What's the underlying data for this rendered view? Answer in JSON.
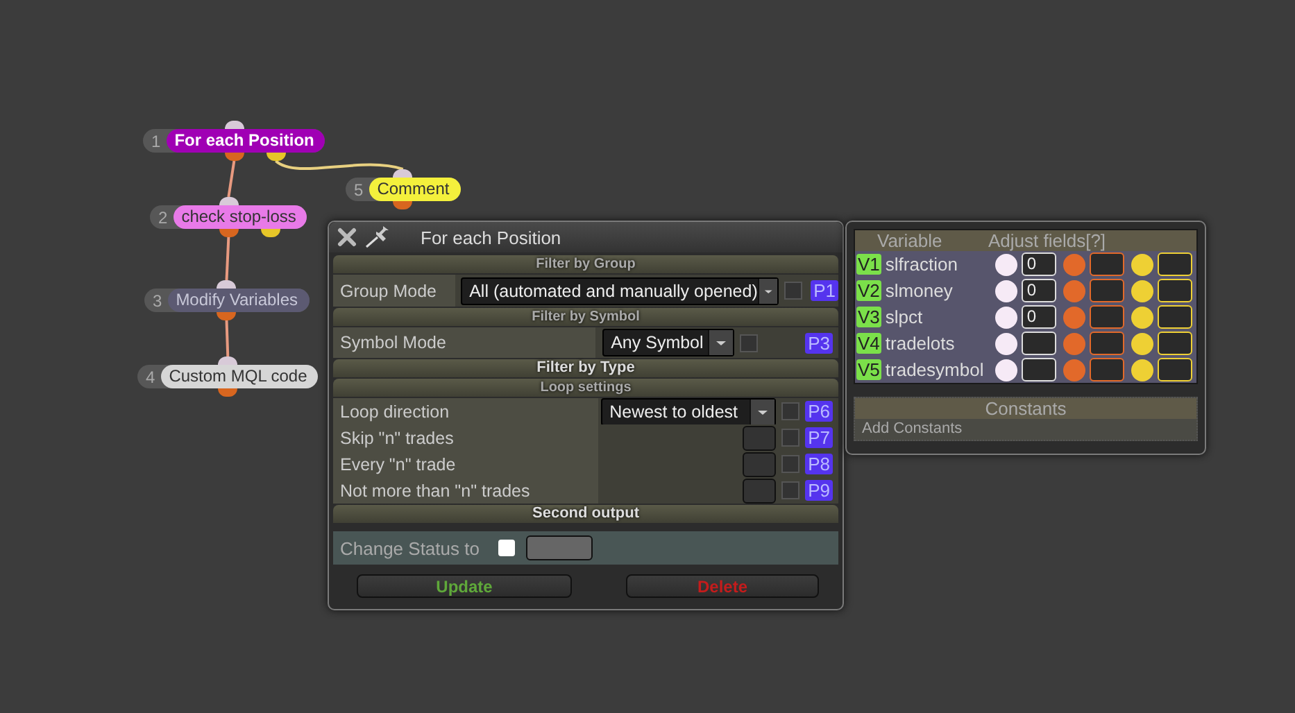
{
  "nodes": [
    {
      "number": "1",
      "label": "For each Position",
      "color": "#a000b4",
      "selected": true,
      "second_output": true
    },
    {
      "number": "5",
      "label": "Comment",
      "color": "#f4f03c",
      "selected": false,
      "second_output": false
    },
    {
      "number": "2",
      "label": "check stop-loss",
      "color": "#e87ae8",
      "selected": false,
      "second_output": true
    },
    {
      "number": "3",
      "label": "Modify Variables",
      "color": "#5c5a72",
      "selected": false,
      "second_output": false
    },
    {
      "number": "4",
      "label": "Custom MQL code",
      "color": "#d6d6d6",
      "selected": false,
      "second_output": false
    }
  ],
  "dialog": {
    "title": "For each Position",
    "sections": [
      {
        "kind": "header",
        "title": "Filter by Group"
      },
      {
        "kind": "wide_dropdown",
        "label": "Group Mode",
        "value": "All (automated and manually opened)",
        "checked": false,
        "param": "P1"
      },
      {
        "kind": "header",
        "title": "Filter by Symbol"
      },
      {
        "kind": "dropdown",
        "label": "Symbol Mode",
        "value": "Any Symbol",
        "checked": false,
        "param": "P3"
      },
      {
        "kind": "bright_header",
        "title": "Filter by Type"
      },
      {
        "kind": "header",
        "title": "Loop settings"
      },
      {
        "kind": "loop_dropdown",
        "label": "Loop direction",
        "value": "Newest to oldest",
        "checked": false,
        "param": "P6"
      },
      {
        "kind": "loop_number",
        "label": "Skip \"n\" trades",
        "checked": false,
        "param": "P7"
      },
      {
        "kind": "loop_number",
        "label": "Every \"n\" trade",
        "checked": false,
        "param": "P8"
      },
      {
        "kind": "loop_number",
        "label": "Not more than \"n\" trades",
        "checked": false,
        "param": "P9"
      },
      {
        "kind": "bright_header",
        "title": "Second output"
      },
      {
        "kind": "status",
        "label": "Change Status to",
        "checked": false
      }
    ],
    "buttons": [
      {
        "label": "Update",
        "kind": "update"
      },
      {
        "label": "Delete",
        "kind": "delete"
      }
    ]
  },
  "variables": {
    "columns": [
      "Variable",
      "Adjust fields[?]"
    ],
    "adjust_fields": [
      {
        "color": "#f6eaf6"
      },
      {
        "color": "#e2692a"
      },
      {
        "color": "#eed034"
      }
    ],
    "rows": [
      {
        "tag": "V1",
        "name": "slfraction",
        "value": "0"
      },
      {
        "tag": "V2",
        "name": "slmoney",
        "value": "0"
      },
      {
        "tag": "V3",
        "name": "slpct",
        "value": "0"
      },
      {
        "tag": "V4",
        "name": "tradelots"
      },
      {
        "tag": "V5",
        "name": "tradesymbol"
      }
    ],
    "constants": {
      "title": "Constants",
      "action": "Add Constants"
    }
  }
}
